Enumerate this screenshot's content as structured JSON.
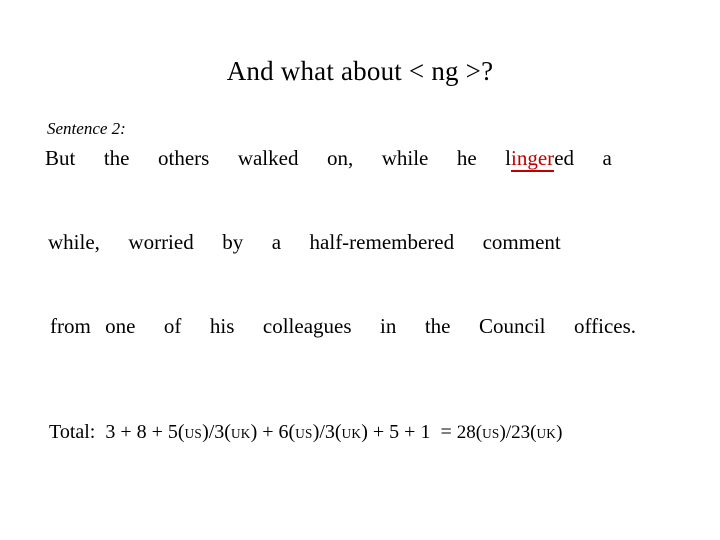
{
  "slide": {
    "title": "And what about < ng >?",
    "label": "Sentence 2:",
    "lines": [
      {
        "pre": "But  the  others  walked  on,  while  he  l",
        "marked": "inger",
        "post": "ed  a"
      },
      {
        "text": "while,  worried  by  a  half-remembered  comment"
      },
      {
        "text": "from one  of  his  colleagues  in  the  Council  offices."
      }
    ],
    "total": {
      "label": "Total:",
      "expr_1": "3 + 8 + 5(",
      "sc_1": "US",
      "expr_2": ")/3(",
      "sc_2": "UK",
      "expr_3": ") + 6(",
      "sc_3": "US",
      "expr_4": ")/3(",
      "sc_4": "UK",
      "expr_5": ") + 5 + 1",
      "equals": "=",
      "result_1": "28(",
      "sc_5": "US",
      "result_2": ")/23(",
      "sc_6": "UK",
      "result_3": ")"
    },
    "colors": {
      "background": "#ffffff",
      "text": "#000000",
      "highlight": "#C00000"
    }
  }
}
